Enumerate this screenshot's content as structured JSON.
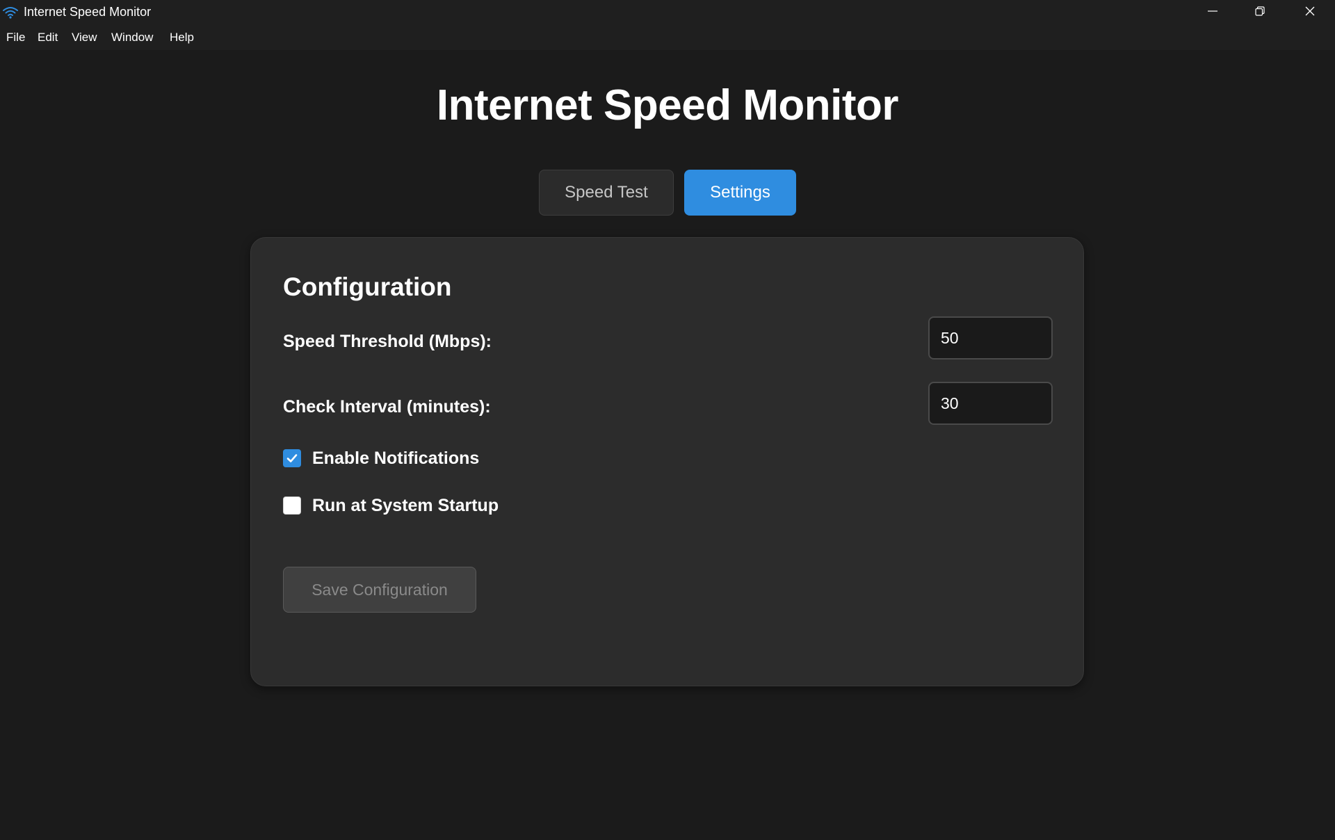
{
  "window": {
    "title": "Internet Speed Monitor",
    "icon": "wifi-icon"
  },
  "menu": {
    "items": [
      "File",
      "Edit",
      "View",
      "Window",
      "Help"
    ]
  },
  "page": {
    "title": "Internet Speed Monitor"
  },
  "tabs": [
    {
      "label": "Speed Test",
      "active": false
    },
    {
      "label": "Settings",
      "active": true
    }
  ],
  "config": {
    "title": "Configuration",
    "speed_threshold": {
      "label": "Speed Threshold (Mbps):",
      "value": "50"
    },
    "check_interval": {
      "label": "Check Interval (minutes):",
      "value": "30"
    },
    "enable_notifications": {
      "label": "Enable Notifications",
      "checked": true
    },
    "run_at_startup": {
      "label": "Run at System Startup",
      "checked": false
    },
    "save_label": "Save Configuration"
  },
  "colors": {
    "accent": "#2f8de0",
    "background": "#1b1b1b",
    "card": "#2c2c2c"
  }
}
